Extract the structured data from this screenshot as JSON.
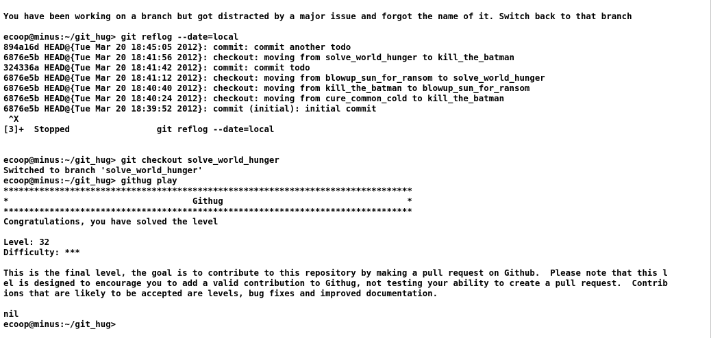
{
  "terminal": {
    "lines": [
      "You have been working on a branch but got distracted by a major issue and forgot the name of it. Switch back to that branch",
      "",
      "ecoop@minus:~/git_hug> git reflog --date=local",
      "894a16d HEAD@{Tue Mar 20 18:45:05 2012}: commit: commit another todo",
      "6876e5b HEAD@{Tue Mar 20 18:41:56 2012}: checkout: moving from solve_world_hunger to kill_the_batman",
      "324336a HEAD@{Tue Mar 20 18:41:42 2012}: commit: commit todo",
      "6876e5b HEAD@{Tue Mar 20 18:41:12 2012}: checkout: moving from blowup_sun_for_ransom to solve_world_hunger",
      "6876e5b HEAD@{Tue Mar 20 18:40:40 2012}: checkout: moving from kill_the_batman to blowup_sun_for_ransom",
      "6876e5b HEAD@{Tue Mar 20 18:40:24 2012}: checkout: moving from cure_common_cold to kill_the_batman",
      "6876e5b HEAD@{Tue Mar 20 18:39:52 2012}: commit (initial): initial commit",
      " ^X",
      "[3]+  Stopped                 git reflog --date=local",
      "",
      "",
      "ecoop@minus:~/git_hug> git checkout solve_world_hunger",
      "Switched to branch 'solve_world_hunger'",
      "ecoop@minus:~/git_hug> githug play",
      "********************************************************************************",
      "*                                    Githug                                    *",
      "********************************************************************************",
      "Congratulations, you have solved the level",
      "",
      "Level: 32",
      "Difficulty: ***",
      "",
      "This is the final level, the goal is to contribute to this repository by making a pull request on Github.  Please note that this l",
      "el is designed to encourage you to add a valid contribution to Githug, not testing your ability to create a pull request.  Contrib",
      "ions that are likely to be accepted are levels, bug fixes and improved documentation.",
      "",
      "nil",
      "ecoop@minus:~/git_hug>"
    ]
  }
}
